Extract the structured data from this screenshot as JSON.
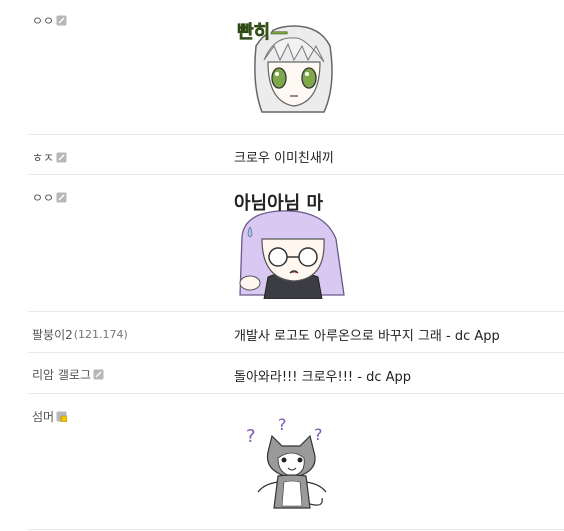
{
  "comments": [
    {
      "nickname": "ㅇㅇ",
      "ip": "",
      "gallog_icon": "fixed-nick-icon",
      "type": "dccon",
      "dccon_text": "빤히—"
    },
    {
      "nickname": "ㅎㅈ",
      "ip": "",
      "gallog_icon": "fixed-nick-icon",
      "type": "text",
      "text": "크로우 이미친새끼"
    },
    {
      "nickname": "ㅇㅇ",
      "ip": "",
      "gallog_icon": "fixed-nick-icon",
      "type": "dccon",
      "dccon_text": "아님아님 마"
    },
    {
      "nickname": "팔붕이2",
      "ip": "(121.174)",
      "type": "text",
      "text": "개발사 로고도 아루온으로 바꾸지 그래 - dc App"
    },
    {
      "nickname": "리암 갤로그",
      "ip": "",
      "gallog_icon": "fixed-nick-icon",
      "type": "text",
      "text": "돌아와라!!! 크로우!!! - dc App"
    },
    {
      "nickname": "섬머",
      "ip": "",
      "gallog_icon": "half-fixed-nick-icon",
      "type": "dccon",
      "dccon_text": ""
    }
  ],
  "colors": {
    "separator": "#e9e9e9",
    "nick_text": "#555555",
    "body_text": "#222222"
  }
}
